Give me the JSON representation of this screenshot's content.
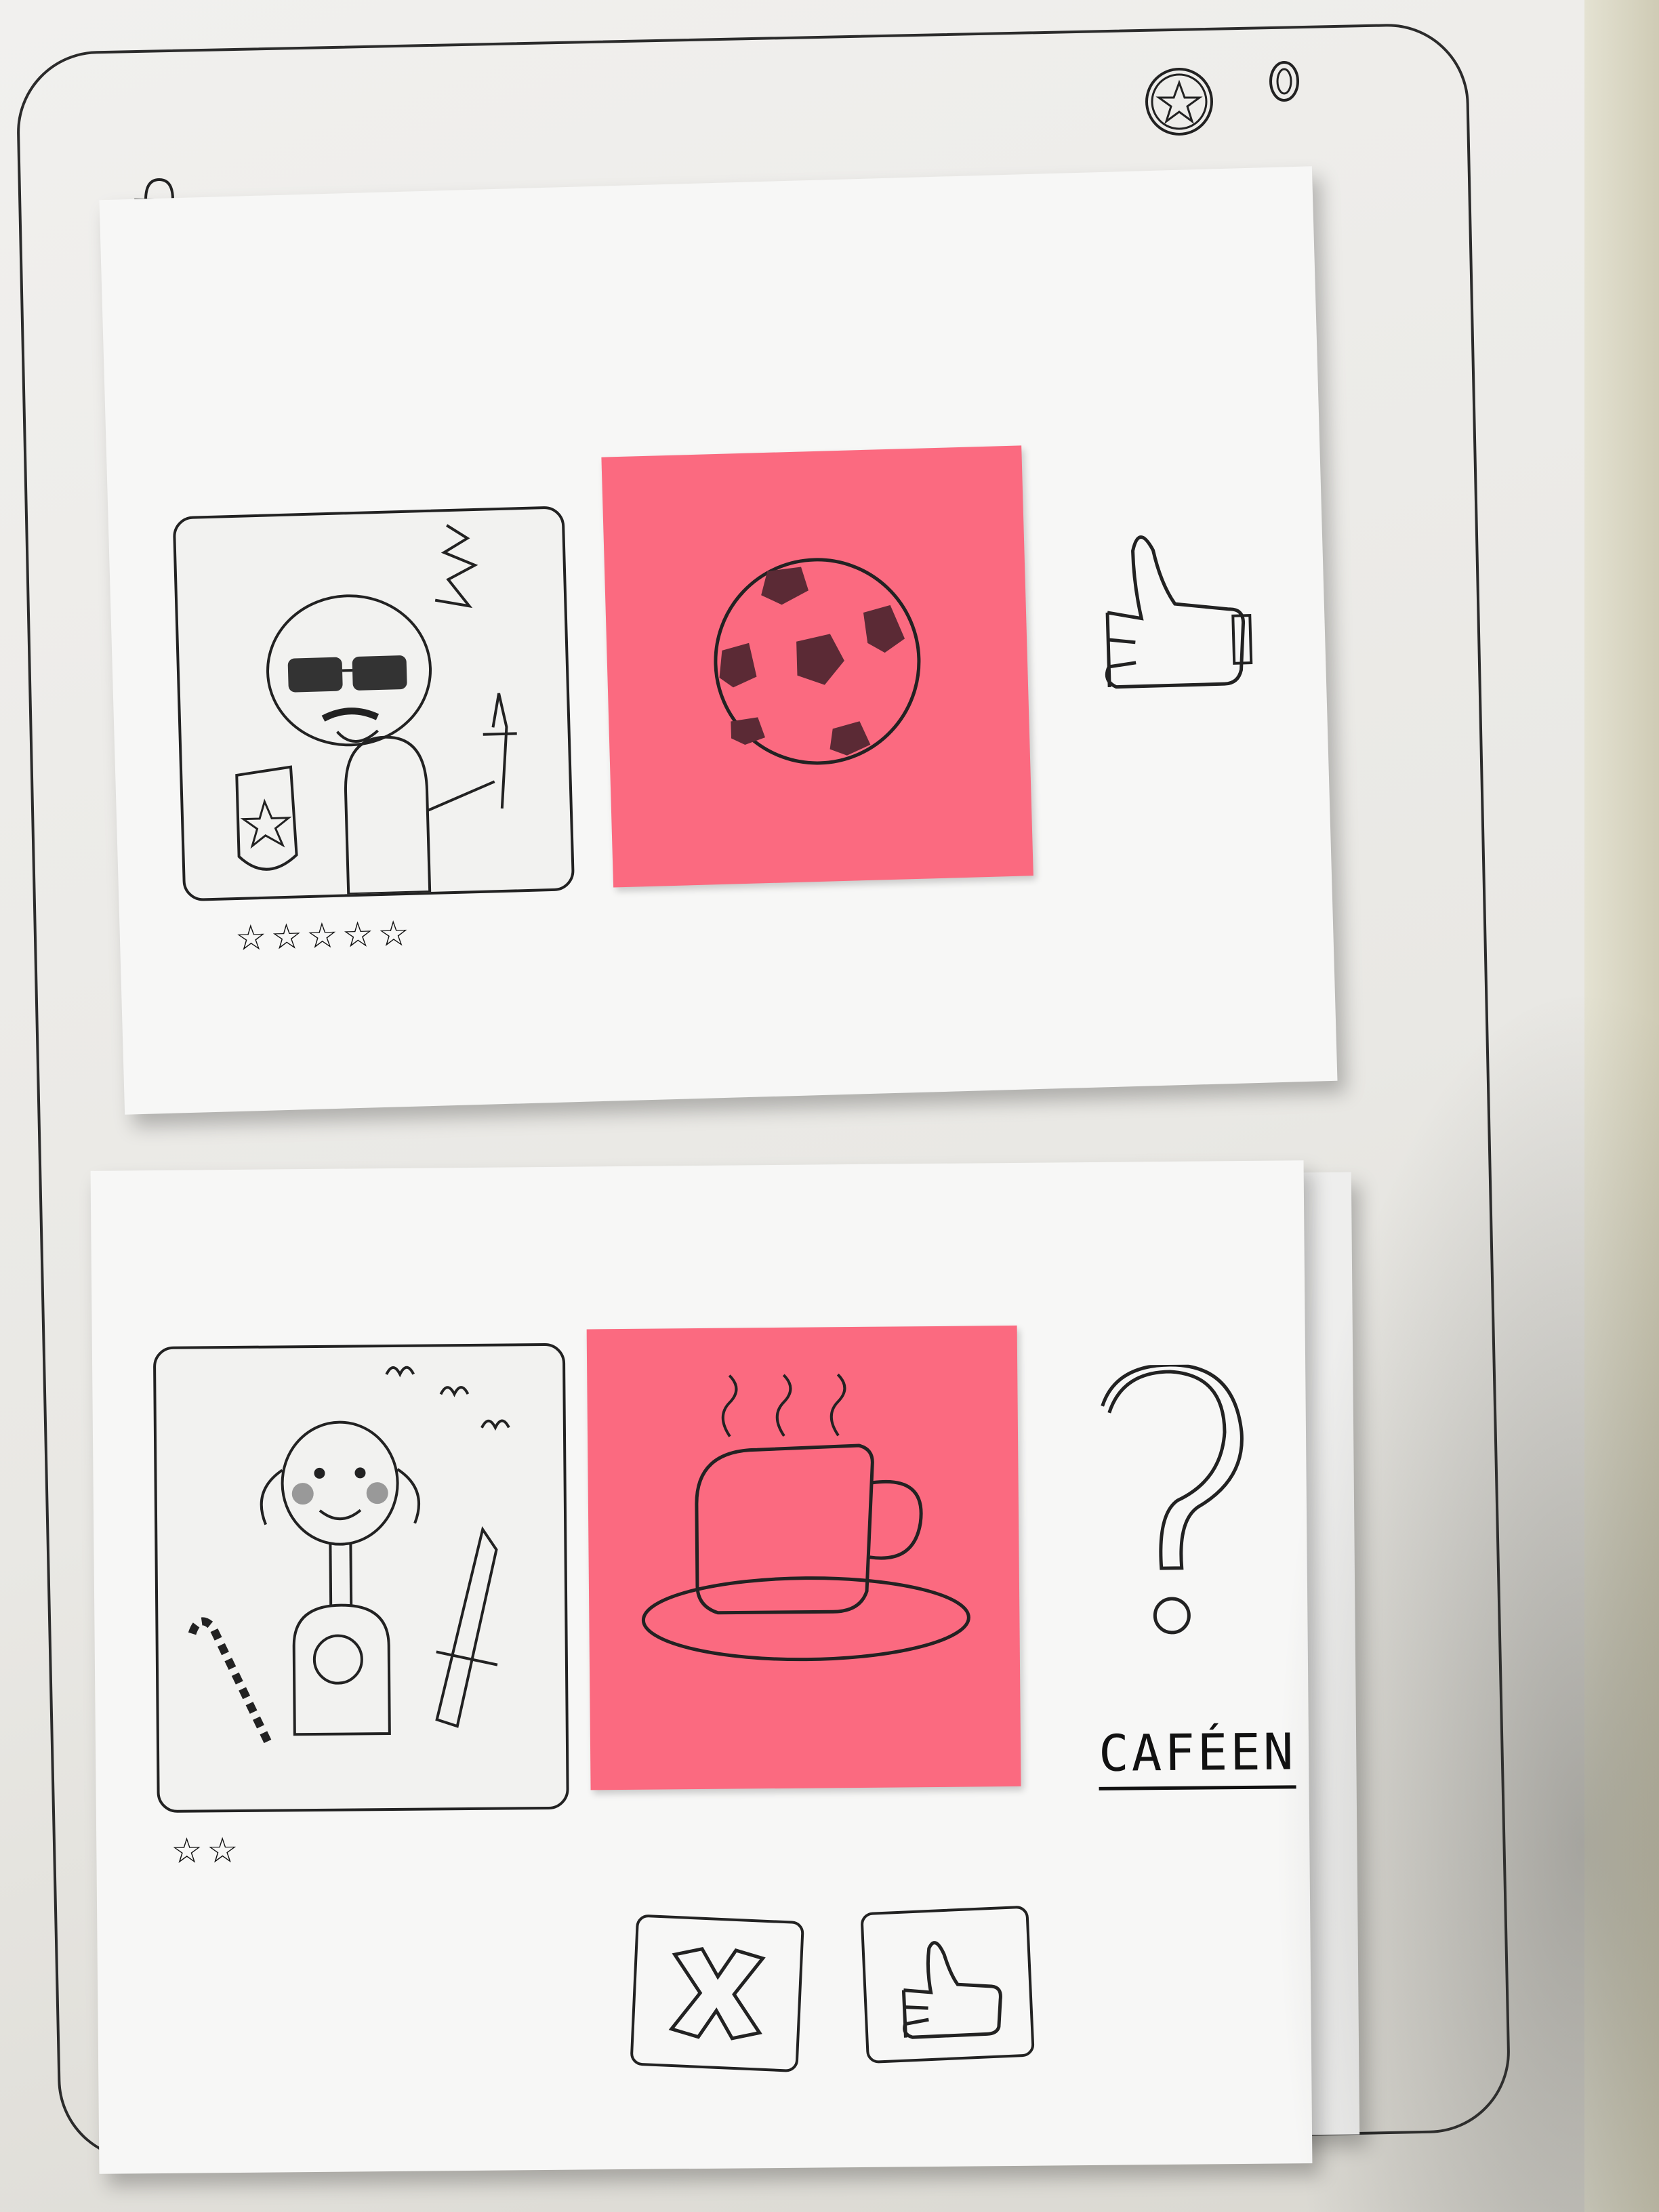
{
  "app": {
    "top_icons": [
      "bag-icon",
      "star-icon",
      "toggle-icon"
    ]
  },
  "cards": [
    {
      "photo_icon": "character-sunglasses-sword-shield",
      "rating_stars": "☆☆☆☆☆",
      "rating_value": 5,
      "interest_icon": "soccer-ball-icon",
      "status_icon": "thumbs-up-icon"
    },
    {
      "photo_icon": "character-pigtails-candy-cane-rifle",
      "rating_stars": "☆☆",
      "rating_value": 2,
      "interest_icon": "coffee-cup-icon",
      "status_icon": "question-mark-icon",
      "interest_label": "CAFÉEN"
    }
  ],
  "actions": {
    "reject_icon": "x-icon",
    "like_icon": "thumbs-up-icon"
  },
  "colors": {
    "postit": "#fb6a80",
    "ink": "#222222",
    "paper": "#f7f7f6"
  }
}
